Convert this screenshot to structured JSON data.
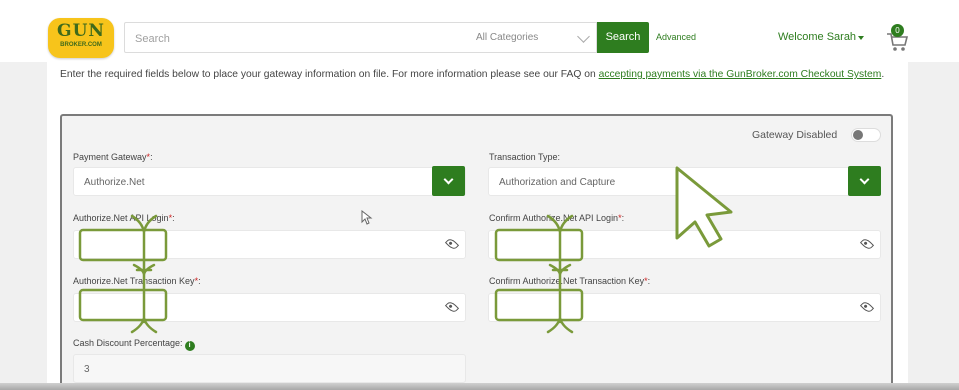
{
  "header": {
    "logo_big": "GUN",
    "logo_small": "BROKER.COM",
    "search_placeholder": "Search",
    "category_selected": "All Categories",
    "search_button": "Search",
    "advanced_link": "Advanced",
    "welcome": "Welcome Sarah",
    "cart_count": "0"
  },
  "intro": {
    "text": "Enter the required fields below to place your gateway information on file. For more information please see our FAQ on ",
    "link": "accepting payments via the GunBroker.com Checkout System",
    "end": "."
  },
  "form": {
    "gateway_toggle_label": "Gateway Disabled",
    "required_mark": "*",
    "payment_gateway_label": "Payment Gateway",
    "payment_gateway_value": "Authorize.Net",
    "transaction_type_label": "Transaction Type:",
    "transaction_type_value": "Authorization and Capture",
    "api_login_label": "Authorize.Net API Login",
    "confirm_api_login_label": "Confirm Authorize.Net API Login",
    "transaction_key_label": "Authorize.Net Transaction Key",
    "confirm_transaction_key_label": "Confirm Authorize.Net Transaction Key",
    "label_suffix": ":",
    "cash_discount_label": "Cash Discount Percentage:",
    "cash_discount_value": "3",
    "info_glyph": "i"
  },
  "icons": [
    "cart-icon",
    "chevron-down-icon",
    "eye-icon",
    "info-icon",
    "cursor-icon"
  ],
  "colors": {
    "brand_green": "#2e7d1f",
    "logo_yellow": "#f7c41b",
    "annotation_green": "#7a9a3a",
    "required_red": "#cc2222"
  }
}
